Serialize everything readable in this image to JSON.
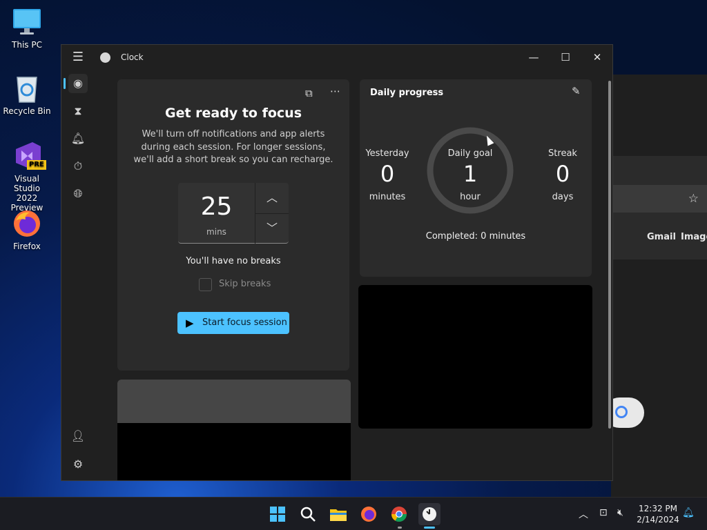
{
  "desktop": {
    "icons": [
      {
        "label": "This PC"
      },
      {
        "label": "Recycle Bin"
      },
      {
        "label": "Visual Studio\n2022 Preview",
        "badge": "PRE"
      },
      {
        "label": "Firefox"
      }
    ]
  },
  "background_browser": {
    "links": [
      "Gmail",
      "Images"
    ]
  },
  "window": {
    "title": "Clock",
    "controls": {
      "minimize": "—",
      "maximize": "☐",
      "close": "✕"
    }
  },
  "sidebar": {
    "items": [
      {
        "name": "focus-sessions",
        "icon": "focus-icon"
      },
      {
        "name": "timer",
        "icon": "hourglass-icon"
      },
      {
        "name": "alarm",
        "icon": "bell-icon"
      },
      {
        "name": "stopwatch",
        "icon": "stopwatch-icon"
      },
      {
        "name": "world-clock",
        "icon": "globe-icon"
      }
    ],
    "bottom": [
      {
        "name": "account",
        "icon": "person-icon"
      },
      {
        "name": "settings",
        "icon": "gear-icon"
      }
    ]
  },
  "focus": {
    "title": "Get ready to focus",
    "description": "We'll turn off notifications and app alerts during each session. For longer sessions, we'll add a short break so you can recharge.",
    "duration_value": "25",
    "duration_unit": "mins",
    "breaks_text": "You'll have no breaks",
    "skip_breaks_label": "Skip breaks",
    "skip_breaks_checked": false,
    "start_label": "Start focus session"
  },
  "daily_progress": {
    "title": "Daily progress",
    "yesterday": {
      "label": "Yesterday",
      "value": "0",
      "unit": "minutes"
    },
    "daily_goal": {
      "label": "Daily goal",
      "value": "1",
      "unit": "hour"
    },
    "streak": {
      "label": "Streak",
      "value": "0",
      "unit": "days"
    },
    "completed_text": "Completed: 0 minutes",
    "goal_fraction": 0
  },
  "taskbar": {
    "apps": [
      {
        "name": "start",
        "icon": "windows-icon"
      },
      {
        "name": "search",
        "icon": "search-icon"
      },
      {
        "name": "file-explorer",
        "icon": "folder-icon"
      },
      {
        "name": "firefox",
        "icon": "firefox-icon"
      },
      {
        "name": "chrome",
        "icon": "chrome-icon"
      },
      {
        "name": "clock",
        "icon": "clock-icon"
      }
    ],
    "time": "12:32 PM",
    "date": "2/14/2024"
  },
  "colors": {
    "accent": "#4cc2ff",
    "window_bg": "#202020",
    "card_bg": "#2b2b2b"
  }
}
